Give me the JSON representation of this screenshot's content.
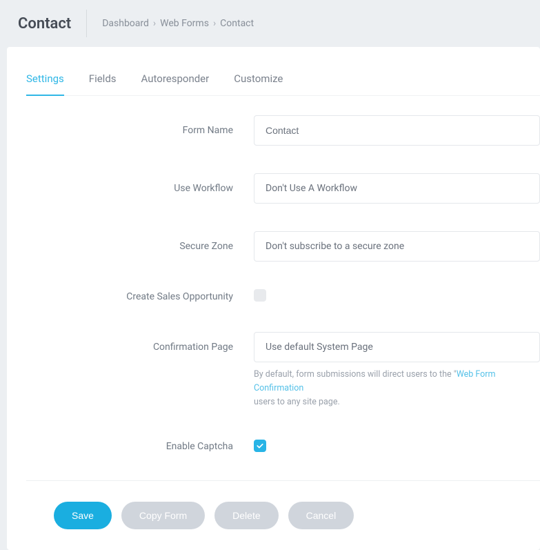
{
  "header": {
    "page_title": "Contact",
    "breadcrumb": [
      "Dashboard",
      "Web Forms",
      "Contact"
    ]
  },
  "tabs": [
    {
      "label": "Settings",
      "active": true
    },
    {
      "label": "Fields",
      "active": false
    },
    {
      "label": "Autoresponder",
      "active": false
    },
    {
      "label": "Customize",
      "active": false
    }
  ],
  "form": {
    "form_name": {
      "label": "Form Name",
      "value": "Contact"
    },
    "use_workflow": {
      "label": "Use Workflow",
      "value": "Don't Use A Workflow"
    },
    "secure_zone": {
      "label": "Secure Zone",
      "value": "Don't subscribe to a secure zone"
    },
    "create_sales_opportunity": {
      "label": "Create Sales Opportunity",
      "checked": false
    },
    "confirmation_page": {
      "label": "Confirmation Page",
      "value": "Use default System Page",
      "help_prefix": "By default, form submissions will direct users to the \"",
      "help_link": "Web Form Confirmation",
      "help_suffix": "users to any site page."
    },
    "enable_captcha": {
      "label": "Enable Captcha",
      "checked": true
    }
  },
  "buttons": {
    "save": "Save",
    "copy_form": "Copy Form",
    "delete": "Delete",
    "cancel": "Cancel"
  }
}
